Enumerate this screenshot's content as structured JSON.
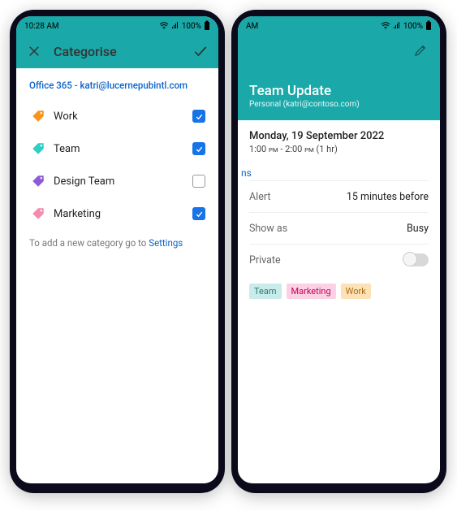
{
  "status": {
    "time": "10:28 AM",
    "battery": "100%",
    "time_cut": "AM"
  },
  "phone1": {
    "title": "Categorise",
    "account": "Office 365 - katri@lucernepubintl.com",
    "categories": [
      {
        "label": "Work",
        "color": "#f7941d",
        "checked": true
      },
      {
        "label": "Team",
        "color": "#2ecfc3",
        "checked": true
      },
      {
        "label": "Design Team",
        "color": "#8e5bd6",
        "checked": false
      },
      {
        "label": "Marketing",
        "color": "#f48bb1",
        "checked": true
      }
    ],
    "hint_prefix": "To add a new category go to ",
    "hint_link": "Settings"
  },
  "phone2": {
    "event_title": "Team Update",
    "event_subtitle": "Personal (katri@contoso.com)",
    "date": "Monday, 19 September 2022",
    "time_start": "1:00",
    "time_start_suffix": "pm",
    "time_sep": " - ",
    "time_end": "2:00",
    "time_end_suffix": "pm",
    "duration": " (1 hr)",
    "cut_link": "ns",
    "rows": {
      "alert_label": "Alert",
      "alert_value": "15 minutes before",
      "show_label": "Show as",
      "show_value": "Busy",
      "private_label": "Private"
    },
    "chips": [
      {
        "label": "Team",
        "bg": "#c9ecea",
        "fg": "#2a7a74"
      },
      {
        "label": "Marketing",
        "bg": "#fbd1e3",
        "fg": "#c4005e"
      },
      {
        "label": "Work",
        "bg": "#fde2b8",
        "fg": "#a96a12"
      }
    ]
  }
}
